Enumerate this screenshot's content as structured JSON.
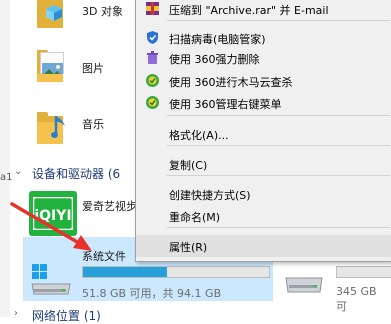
{
  "explorer": {
    "folders": [
      {
        "name": "3D 对象",
        "icon": "3d-objects-folder-icon"
      },
      {
        "name": "图片",
        "icon": "pictures-folder-icon"
      },
      {
        "name": "音乐",
        "icon": "music-folder-icon"
      }
    ],
    "sections": {
      "devices": "设备和驱动器 (6",
      "network": "网络位置 (1)"
    },
    "left_strip_mark": "a1",
    "devices": [
      {
        "name": "爱奇艺视步",
        "icon": "iqiyi-app-icon"
      },
      {
        "name": "系统文件",
        "icon": "windows-drive-icon",
        "used_fraction": 0.45,
        "size_text": "51.8 GB 可用，共 94.1 GB"
      },
      {
        "name": "",
        "icon": "hard-drive-icon",
        "size_text": "345 GB 可"
      }
    ]
  },
  "context_menu": {
    "items": [
      {
        "label": "压缩到 \"Archive.rar\" 并 E-mail",
        "icon": "winrar-icon"
      },
      {
        "separator": true
      },
      {
        "label": "扫描病毒(电脑管家)",
        "icon": "shield-icon"
      },
      {
        "label": "使用 360强力删除",
        "icon": "trash-360-icon"
      },
      {
        "label": "使用 360进行木马云查杀",
        "icon": "360-security-icon"
      },
      {
        "label": "使用 360管理右键菜单",
        "icon": "360-security-icon"
      },
      {
        "separator": true
      },
      {
        "label": "格式化(A)..."
      },
      {
        "separator": true
      },
      {
        "label": "复制(C)"
      },
      {
        "separator": true
      },
      {
        "label": "创建快捷方式(S)"
      },
      {
        "label": "重命名(M)"
      },
      {
        "separator": true
      },
      {
        "label": "属性(R)",
        "highlighted": true
      }
    ]
  },
  "colors": {
    "menu_bg": "#f0f0f0",
    "selection": "#cce8ff",
    "progress": "#26a0da",
    "arrow": "#e8312a",
    "header_text": "#1e3a78"
  }
}
